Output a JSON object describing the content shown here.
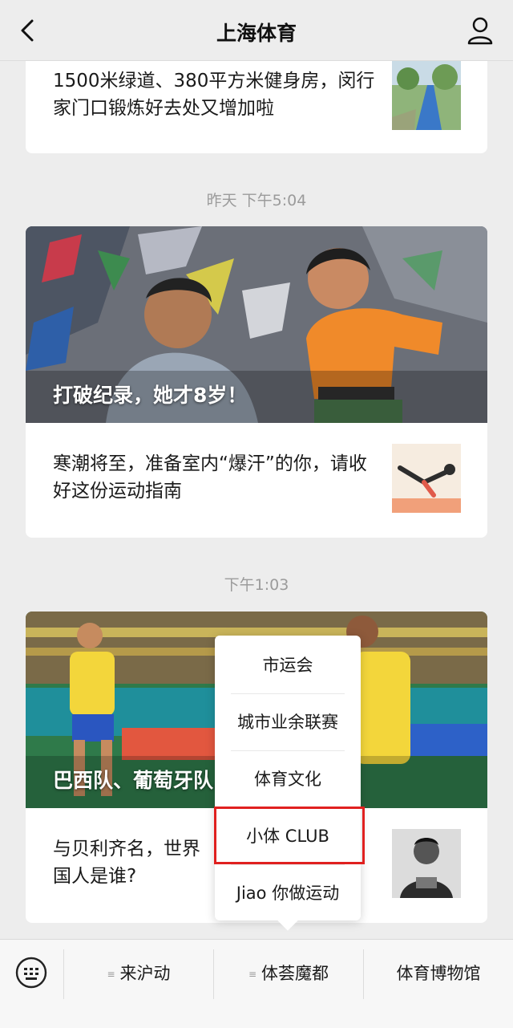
{
  "header": {
    "title": "上海体育"
  },
  "feed": {
    "article1": {
      "title": "1500米绿道、380平方米健身房，闵行家门口锻炼好去处又增加啦"
    },
    "time1": "昨天 下午5:04",
    "article2": {
      "hero_title": "打破纪录，她才8岁！"
    },
    "article3": {
      "title": "寒潮将至，准备室内“爆汗”的你，请收好这份运动指南"
    },
    "time2": "下午1:03",
    "article4": {
      "hero_title": "巴西队、葡萄牙队……出线！"
    },
    "article5": {
      "title": "与贝利齐名，世界……中国人是谁？",
      "line1": "与贝利齐名，世界",
      "line2": "国人是谁?"
    },
    "colors": {
      "accent_red": "#e0201f",
      "hero2_grass": "#2f7a4a"
    }
  },
  "popup": {
    "items": [
      "市运会",
      "城市业余联赛",
      "体育文化",
      "小体 CLUB",
      "Jiao 你做运动"
    ],
    "highlighted": "小体 CLUB"
  },
  "bottom_menu": {
    "items": [
      "来沪动",
      "体荟魔都",
      "体育博物馆"
    ]
  },
  "icons": [
    "back-arrow-icon",
    "profile-icon",
    "keyboard-icon",
    "menu-lines-icon"
  ]
}
